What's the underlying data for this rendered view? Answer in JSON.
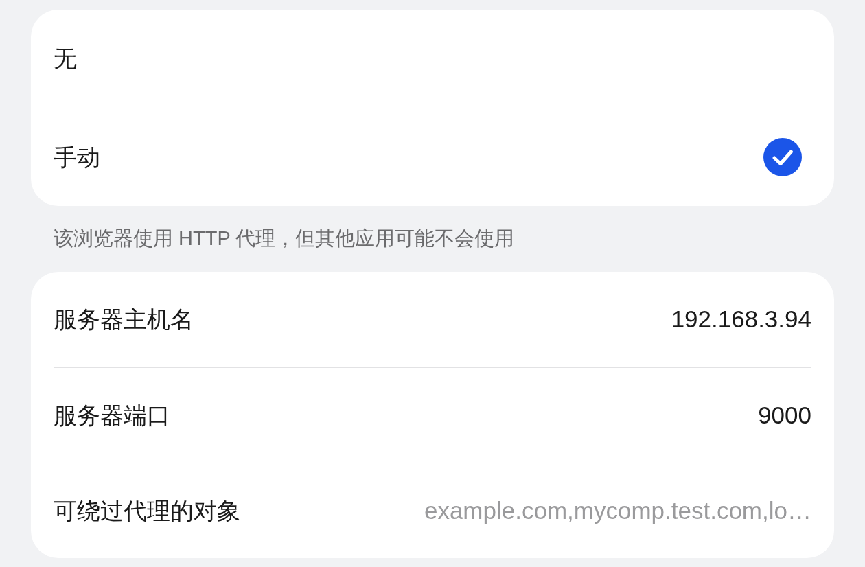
{
  "proxy_modes": [
    {
      "label": "无",
      "selected": false
    },
    {
      "label": "手动",
      "selected": true
    }
  ],
  "note": "该浏览器使用 HTTP 代理，但其他应用可能不会使用",
  "fields": [
    {
      "label": "服务器主机名",
      "value": "192.168.3.94"
    },
    {
      "label": "服务器端口",
      "value": "9000"
    },
    {
      "label": "可绕过代理的对象",
      "placeholder": "example.com,mycomp.test.com,lo…"
    }
  ]
}
